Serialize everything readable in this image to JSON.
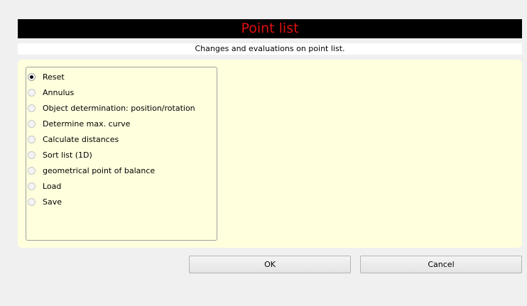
{
  "dialog": {
    "title": "Point list",
    "subtitle": "Changes and evaluations on point list."
  },
  "options": [
    {
      "label": "Reset",
      "checked": true
    },
    {
      "label": "Annulus",
      "checked": false
    },
    {
      "label": "Object determination: position/rotation",
      "checked": false
    },
    {
      "label": "Determine max. curve",
      "checked": false
    },
    {
      "label": "Calculate distances",
      "checked": false
    },
    {
      "label": "Sort list (1D)",
      "checked": false
    },
    {
      "label": "geometrical point of balance",
      "checked": false
    },
    {
      "label": "Load",
      "checked": false
    },
    {
      "label": "Save",
      "checked": false
    }
  ],
  "buttons": {
    "ok": "OK",
    "cancel": "Cancel"
  },
  "colors": {
    "title_background": "#000000",
    "title_text": "#e01010",
    "panel_background": "#ffffde"
  }
}
